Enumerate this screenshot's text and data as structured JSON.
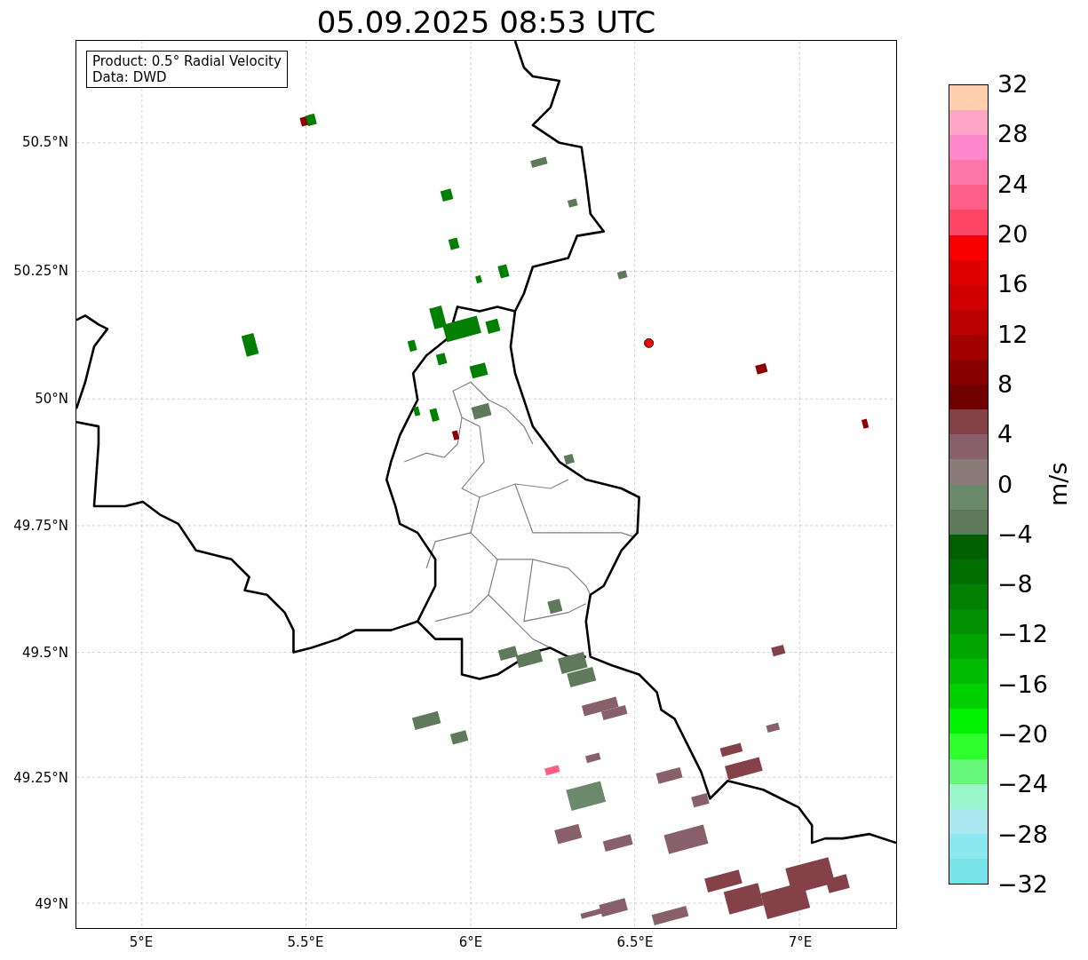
{
  "title": "05.09.2025 08:53 UTC",
  "info_box": [
    "Product: 0.5° Radial Velocity",
    "Data: DWD"
  ],
  "map": {
    "yticks": [
      "50.5°N",
      "50.25°N",
      "50°N",
      "49.75°N",
      "49.5°N",
      "49.25°N",
      "49°N"
    ],
    "xticks": [
      "5°E",
      "5.5°E",
      "6°E",
      "6.5°E",
      "7°E"
    ]
  },
  "colorbar": {
    "label": "m/s",
    "ticks": [
      "32",
      "28",
      "24",
      "20",
      "16",
      "12",
      "8",
      "4",
      "0",
      "−4",
      "−8",
      "−12",
      "−16",
      "−20",
      "−24",
      "−28",
      "−32"
    ],
    "segments": [
      {
        "color": "#ffcfaf"
      },
      {
        "color": "#ffa6c6"
      },
      {
        "color": "#ff88cc"
      },
      {
        "color": "#ff77a8"
      },
      {
        "color": "#ff5e88"
      },
      {
        "color": "#ff4466"
      },
      {
        "color": "#f80000"
      },
      {
        "color": "#e00000"
      },
      {
        "color": "#d00000"
      },
      {
        "color": "#bb0000"
      },
      {
        "color": "#a50000"
      },
      {
        "color": "#8a0000"
      },
      {
        "color": "#700000"
      },
      {
        "color": "#844248"
      },
      {
        "color": "#88606c"
      },
      {
        "color": "#8a7a78"
      },
      {
        "color": "#6b8a6b"
      },
      {
        "color": "#5e7a5a"
      },
      {
        "color": "#005f00"
      },
      {
        "color": "#006e00"
      },
      {
        "color": "#007f00"
      },
      {
        "color": "#009000"
      },
      {
        "color": "#00a500"
      },
      {
        "color": "#00bb00"
      },
      {
        "color": "#00d000"
      },
      {
        "color": "#00f000"
      },
      {
        "color": "#2dff2d"
      },
      {
        "color": "#66f77a"
      },
      {
        "color": "#9af5cc"
      },
      {
        "color": "#a8e8ee"
      },
      {
        "color": "#8ae8ee"
      },
      {
        "color": "#77e3e8"
      }
    ]
  }
}
